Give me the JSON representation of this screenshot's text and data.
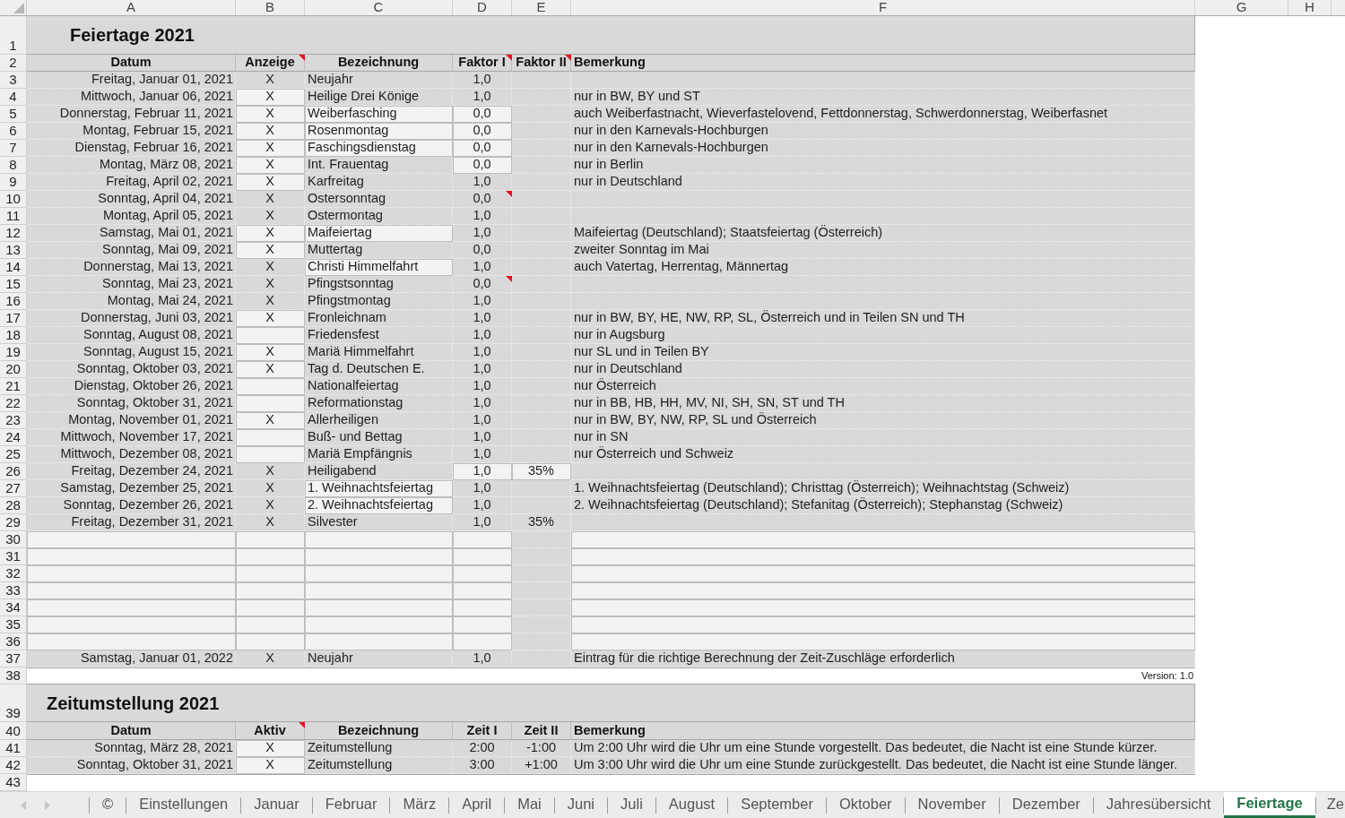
{
  "column_headers": [
    "A",
    "B",
    "C",
    "D",
    "E",
    "F",
    "G",
    "H"
  ],
  "holidays": {
    "title": {
      "row": "1",
      "text": "Feiertage 2021"
    },
    "header": {
      "row": "2",
      "columns": [
        {
          "label": "Datum",
          "comment": false
        },
        {
          "label": "Anzeige",
          "comment": true
        },
        {
          "label": "Bezeichnung",
          "comment": false
        },
        {
          "label": "Faktor I",
          "comment": true
        },
        {
          "label": "Faktor II",
          "comment": true
        },
        {
          "label": "Bemerkung",
          "comment": false
        }
      ]
    },
    "rows": [
      {
        "row": "3",
        "datum": "Freitag, Januar 01, 2021",
        "anzeige": "X",
        "bezeichnung": "Neujahr",
        "faktor_1": "1,0",
        "comment": false
      },
      {
        "row": "4",
        "datum": "Mittwoch, Januar 06, 2021",
        "anzeige": "X",
        "bezeichnung": "Heilige Drei Könige",
        "faktor_1": "1,0",
        "bemerkung": "nur in BW, BY und ST",
        "highlight": {
          "anzeige": true
        },
        "comment": false
      },
      {
        "row": "5",
        "datum": "Donnerstag, Februar 11, 2021",
        "anzeige": "X",
        "bezeichnung": "Weiberfasching",
        "faktor_1": "0,0",
        "bemerkung": "auch Weiberfastnacht, Wieverfastelovend, Fettdonnerstag, Schwerdonnerstag, Weiberfasnet",
        "highlight": {
          "anzeige": true,
          "bezeichnung": true,
          "faktor_1": true
        },
        "comment": false
      },
      {
        "row": "6",
        "datum": "Montag, Februar 15, 2021",
        "anzeige": "X",
        "bezeichnung": "Rosenmontag",
        "faktor_1": "0,0",
        "bemerkung": "nur in den Karnevals-Hochburgen",
        "highlight": {
          "anzeige": true,
          "bezeichnung": true,
          "faktor_1": true
        },
        "comment": false
      },
      {
        "row": "7",
        "datum": "Dienstag, Februar 16, 2021",
        "anzeige": "X",
        "bezeichnung": "Faschingsdienstag",
        "faktor_1": "0,0",
        "bemerkung": "nur in den Karnevals-Hochburgen",
        "highlight": {
          "anzeige": true,
          "bezeichnung": true,
          "faktor_1": true
        },
        "comment": false
      },
      {
        "row": "8",
        "datum": "Montag, März 08, 2021",
        "anzeige": "X",
        "bezeichnung": "Int. Frauentag",
        "faktor_1": "0,0",
        "bemerkung": "nur in Berlin",
        "highlight": {
          "anzeige": true,
          "faktor_1": true
        },
        "comment": false
      },
      {
        "row": "9",
        "datum": "Freitag, April 02, 2021",
        "anzeige": "X",
        "bezeichnung": "Karfreitag",
        "faktor_1": "1,0",
        "bemerkung": "nur in Deutschland",
        "highlight": {
          "anzeige": true
        },
        "comment": false
      },
      {
        "row": "10",
        "datum": "Sonntag, April 04, 2021",
        "anzeige": "X",
        "bezeichnung": "Ostersonntag",
        "faktor_1": "0,0",
        "comment": true
      },
      {
        "row": "11",
        "datum": "Montag, April 05, 2021",
        "anzeige": "X",
        "bezeichnung": "Ostermontag",
        "faktor_1": "1,0",
        "comment": false
      },
      {
        "row": "12",
        "datum": "Samstag, Mai 01, 2021",
        "anzeige": "X",
        "bezeichnung": "Maifeiertag",
        "faktor_1": "1,0",
        "bemerkung": "Maifeiertag (Deutschland); Staatsfeiertag (Österreich)",
        "highlight": {
          "anzeige": true,
          "bezeichnung": true
        },
        "comment": false
      },
      {
        "row": "13",
        "datum": "Sonntag, Mai 09, 2021",
        "anzeige": "X",
        "bezeichnung": "Muttertag",
        "faktor_1": "0,0",
        "bemerkung": "zweiter Sonntag im Mai",
        "highlight": {
          "anzeige": true
        },
        "comment": false
      },
      {
        "row": "14",
        "datum": "Donnerstag, Mai 13, 2021",
        "anzeige": "X",
        "bezeichnung": "Christi Himmelfahrt",
        "faktor_1": "1,0",
        "bemerkung": "auch Vatertag, Herrentag, Männertag",
        "highlight": {
          "bezeichnung": true
        },
        "comment": false
      },
      {
        "row": "15",
        "datum": "Sonntag, Mai 23, 2021",
        "anzeige": "X",
        "bezeichnung": "Pfingstsonntag",
        "faktor_1": "0,0",
        "comment": true
      },
      {
        "row": "16",
        "datum": "Montag, Mai 24, 2021",
        "anzeige": "X",
        "bezeichnung": "Pfingstmontag",
        "faktor_1": "1,0",
        "comment": false
      },
      {
        "row": "17",
        "datum": "Donnerstag, Juni 03, 2021",
        "anzeige": "X",
        "bezeichnung": "Fronleichnam",
        "faktor_1": "1,0",
        "bemerkung": "nur in BW, BY, HE, NW, RP, SL, Österreich und in Teilen SN und TH",
        "highlight": {
          "anzeige": true
        },
        "comment": false
      },
      {
        "row": "18",
        "datum": "Sonntag, August 08, 2021",
        "bezeichnung": "Friedensfest",
        "faktor_1": "1,0",
        "bemerkung": "nur in Augsburg",
        "highlight": {
          "anzeige": true
        },
        "comment": false
      },
      {
        "row": "19",
        "datum": "Sonntag, August 15, 2021",
        "anzeige": "X",
        "bezeichnung": "Mariä Himmelfahrt",
        "faktor_1": "1,0",
        "bemerkung": "nur SL und in Teilen BY",
        "highlight": {
          "anzeige": true
        },
        "comment": false
      },
      {
        "row": "20",
        "datum": "Sonntag, Oktober 03, 2021",
        "anzeige": "X",
        "bezeichnung": "Tag d. Deutschen E.",
        "faktor_1": "1,0",
        "bemerkung": "nur in Deutschland",
        "highlight": {
          "anzeige": true
        },
        "comment": false
      },
      {
        "row": "21",
        "datum": "Dienstag, Oktober 26, 2021",
        "bezeichnung": "Nationalfeiertag",
        "faktor_1": "1,0",
        "bemerkung": "nur Österreich",
        "highlight": {
          "anzeige": true
        },
        "comment": false
      },
      {
        "row": "22",
        "datum": "Sonntag, Oktober 31, 2021",
        "bezeichnung": "Reformationstag",
        "faktor_1": "1,0",
        "bemerkung": "nur in BB, HB, HH, MV, NI, SH, SN, ST und TH",
        "highlight": {
          "anzeige": true
        },
        "comment": false
      },
      {
        "row": "23",
        "datum": "Montag, November 01, 2021",
        "anzeige": "X",
        "bezeichnung": "Allerheiligen",
        "faktor_1": "1,0",
        "bemerkung": "nur in BW, BY, NW, RP, SL und Österreich",
        "highlight": {
          "anzeige": true
        },
        "comment": false
      },
      {
        "row": "24",
        "datum": "Mittwoch, November 17, 2021",
        "bezeichnung": "Buß- und Bettag",
        "faktor_1": "1,0",
        "bemerkung": "nur in SN",
        "highlight": {
          "anzeige": true
        },
        "comment": false
      },
      {
        "row": "25",
        "datum": "Mittwoch, Dezember 08, 2021",
        "bezeichnung": "Mariä Empfängnis",
        "faktor_1": "1,0",
        "bemerkung": "nur Österreich und Schweiz",
        "highlight": {
          "anzeige": true
        },
        "comment": false
      },
      {
        "row": "26",
        "datum": "Freitag, Dezember 24, 2021",
        "anzeige": "X",
        "bezeichnung": "Heiligabend",
        "faktor_1": "1,0",
        "faktor_2": "35%",
        "highlight": {
          "faktor_1": true,
          "faktor_2": true
        },
        "comment": false
      },
      {
        "row": "27",
        "datum": "Samstag, Dezember 25, 2021",
        "anzeige": "X",
        "bezeichnung": "1. Weihnachtsfeiertag",
        "faktor_1": "1,0",
        "bemerkung": "1. Weihnachtsfeiertag (Deutschland); Christtag (Österreich); Weihnachtstag (Schweiz)",
        "highlight": {
          "bezeichnung": true
        },
        "comment": false
      },
      {
        "row": "28",
        "datum": "Sonntag, Dezember 26, 2021",
        "anzeige": "X",
        "bezeichnung": "2. Weihnachtsfeiertag",
        "faktor_1": "1,0",
        "bemerkung": "2. Weihnachtsfeiertag (Deutschland); Stefanitag (Österreich); Stephanstag (Schweiz)",
        "highlight": {
          "bezeichnung": true
        },
        "comment": false
      },
      {
        "row": "29",
        "datum": "Freitag, Dezember 31, 2021",
        "anzeige": "X",
        "bezeichnung": "Silvester",
        "faktor_1": "1,0",
        "faktor_2": "35%",
        "comment": false
      },
      {
        "row": "30",
        "highlight": {
          "datum": true,
          "anzeige": true,
          "bezeichnung": true,
          "faktor_1": true,
          "bemerkung": true
        },
        "comment": false
      },
      {
        "row": "31",
        "highlight": {
          "datum": true,
          "anzeige": true,
          "bezeichnung": true,
          "faktor_1": true,
          "bemerkung": true
        },
        "comment": false
      },
      {
        "row": "32",
        "highlight": {
          "datum": true,
          "anzeige": true,
          "bezeichnung": true,
          "faktor_1": true,
          "bemerkung": true
        },
        "comment": false
      },
      {
        "row": "33",
        "highlight": {
          "datum": true,
          "anzeige": true,
          "bezeichnung": true,
          "faktor_1": true,
          "bemerkung": true
        },
        "comment": false
      },
      {
        "row": "34",
        "highlight": {
          "datum": true,
          "anzeige": true,
          "bezeichnung": true,
          "faktor_1": true,
          "bemerkung": true
        },
        "comment": false
      },
      {
        "row": "35",
        "highlight": {
          "datum": true,
          "anzeige": true,
          "bezeichnung": true,
          "faktor_1": true,
          "bemerkung": true
        },
        "comment": false
      },
      {
        "row": "36",
        "highlight": {
          "datum": true,
          "anzeige": true,
          "bezeichnung": true,
          "faktor_1": true,
          "bemerkung": true
        },
        "comment": false
      },
      {
        "row": "37",
        "datum": "Samstag, Januar 01, 2022",
        "anzeige": "X",
        "bezeichnung": "Neujahr",
        "faktor_1": "1,0",
        "bemerkung": "Eintrag für die richtige Berechnung der Zeit-Zuschläge erforderlich",
        "comment": false
      }
    ],
    "version": {
      "row": "38",
      "text": "Version: 1.0"
    }
  },
  "time_change": {
    "title": {
      "row": "39",
      "text": "Zeitumstellung 2021"
    },
    "header": {
      "row": "40",
      "columns": [
        {
          "label": "Datum",
          "comment": false
        },
        {
          "label": "Aktiv",
          "comment": true
        },
        {
          "label": "Bezeichnung",
          "comment": false
        },
        {
          "label": "Zeit I",
          "comment": false
        },
        {
          "label": "Zeit II",
          "comment": false
        },
        {
          "label": "Bemerkung",
          "comment": false
        }
      ]
    },
    "rows": [
      {
        "row": "41",
        "datum": "Sonntag, März 28, 2021",
        "aktiv": "X",
        "bezeichnung": "Zeitumstellung",
        "zeit_1": "2:00",
        "zeit_2": "-1:00",
        "bemerkung": "Um 2:00 Uhr wird die Uhr um eine Stunde vorgestellt. Das bedeutet, die Nacht ist eine Stunde kürzer.",
        "highlight": {
          "aktiv": true
        }
      },
      {
        "row": "42",
        "datum": "Sonntag, Oktober 31, 2021",
        "aktiv": "X",
        "bezeichnung": "Zeitumstellung",
        "zeit_1": "3:00",
        "zeit_2": "+1:00",
        "bemerkung": "Um 3:00 Uhr wird die Uhr um eine Stunde zurückgestellt. Das bedeutet, die Nacht ist eine Stunde länger.",
        "highlight": {
          "aktiv": true
        }
      }
    ]
  },
  "empty_row": {
    "row": "43"
  },
  "sheet_tabs": [
    {
      "label": "©",
      "selected": false
    },
    {
      "label": "Einstellungen",
      "selected": false
    },
    {
      "label": "Januar",
      "selected": false
    },
    {
      "label": "Februar",
      "selected": false
    },
    {
      "label": "März",
      "selected": false
    },
    {
      "label": "April",
      "selected": false
    },
    {
      "label": "Mai",
      "selected": false
    },
    {
      "label": "Juni",
      "selected": false
    },
    {
      "label": "Juli",
      "selected": false
    },
    {
      "label": "August",
      "selected": false
    },
    {
      "label": "September",
      "selected": false
    },
    {
      "label": "Oktober",
      "selected": false
    },
    {
      "label": "November",
      "selected": false
    },
    {
      "label": "Dezember",
      "selected": false
    },
    {
      "label": "Jahresübersicht",
      "selected": false
    },
    {
      "label": "Feiertage",
      "selected": true
    },
    {
      "label": "Ze",
      "selected": false
    }
  ]
}
